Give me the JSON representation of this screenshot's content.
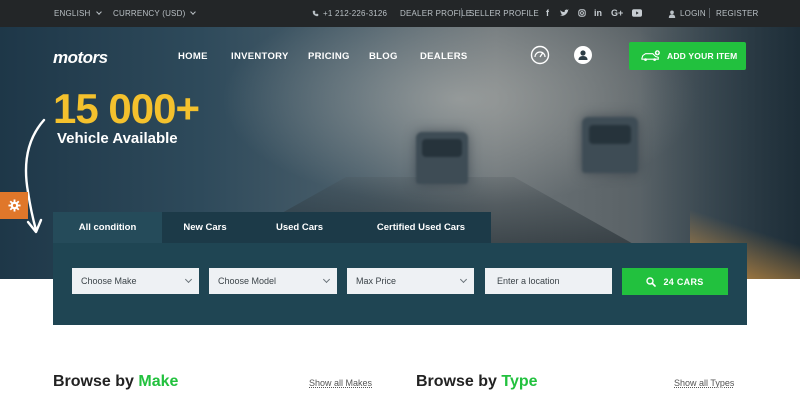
{
  "topbar": {
    "language": "ENGLISH",
    "currency": "CURRENCY (USD)",
    "phone": "+1 212-226-3126",
    "dealer_profile": "DEALER PROFILE",
    "seller_profile": "SELLER PROFILE",
    "social": [
      "f",
      "t",
      "ig",
      "in",
      "G+",
      "yt"
    ],
    "login": "LOGIN",
    "register": "REGISTER"
  },
  "header": {
    "logo": "motors",
    "nav": [
      "HOME",
      "INVENTORY",
      "PRICING",
      "BLOG",
      "DEALERS"
    ],
    "add_item": "ADD YOUR ITEM"
  },
  "hero": {
    "count": "15 000+",
    "subtitle": "Vehicle Available"
  },
  "search": {
    "tabs": [
      "All condition",
      "New Cars",
      "Used Cars",
      "Certified Used Cars"
    ],
    "active_tab": 0,
    "make": "Choose Make",
    "model": "Choose Model",
    "price": "Max Price",
    "location_placeholder": "Enter a location",
    "button": "24 CARS"
  },
  "browse": {
    "make_prefix": "Browse by ",
    "make_highlight": "Make",
    "make_link": "Show all Makes",
    "type_prefix": "Browse by ",
    "type_highlight": "Type",
    "type_link": "Show all Types"
  },
  "colors": {
    "accent": "#22c13e",
    "gold": "#f4c12d",
    "panel": "#1f4553",
    "settings": "#e0772a"
  }
}
